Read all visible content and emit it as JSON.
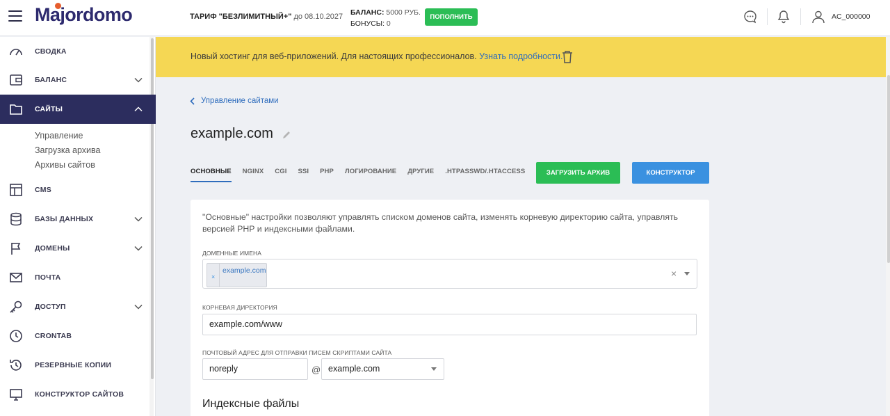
{
  "header": {
    "logo": "Majordomo",
    "tariff_label": "ТАРИФ \"БЕЗЛИМИТНЫЙ+\"",
    "tariff_until": "до 08.10.2027",
    "balance_label": "БАЛАНС:",
    "balance_value": "5000 РУБ.",
    "bonus_label": "БОНУСЫ:",
    "bonus_value": "0",
    "topup_label": "ПОПОЛНИТЬ",
    "user_name": "AC_000000"
  },
  "sidebar": {
    "items": [
      {
        "label": "СВОДКА",
        "icon": "gauge-icon"
      },
      {
        "label": "БАЛАНС",
        "icon": "wallet-icon"
      },
      {
        "label": "САЙТЫ",
        "icon": "folder-icon"
      },
      {
        "label": "CMS",
        "icon": "layout-icon"
      },
      {
        "label": "БАЗЫ ДАННЫХ",
        "icon": "database-icon"
      },
      {
        "label": "ДОМЕНЫ",
        "icon": "flag-icon"
      },
      {
        "label": "ПОЧТА",
        "icon": "mail-icon"
      },
      {
        "label": "ДОСТУП",
        "icon": "key-icon"
      },
      {
        "label": "CRONTAB",
        "icon": "clock-icon"
      },
      {
        "label": "РЕЗЕРВНЫЕ КОПИИ",
        "icon": "history-icon"
      },
      {
        "label": "КОНСТРУКТОР САЙТОВ",
        "icon": "monitor-icon"
      }
    ],
    "sites_sub": [
      "Управление",
      "Загрузка архива",
      "Архивы сайтов"
    ]
  },
  "banner": {
    "text": "Новый хостинг для веб-приложений. Для настоящих профессионалов.",
    "link": "Узнать подробности."
  },
  "main": {
    "breadcrumb": "Управление сайтами",
    "title": "example.com",
    "tabs": [
      "ОСНОВНЫЕ",
      "NGINX",
      "CGI",
      "SSI",
      "PHP",
      "ЛОГИРОВАНИЕ",
      "ДРУГИЕ",
      ".HTPASSWD/.HTACCESS"
    ],
    "upload_archive_label": "ЗАГРУЗИТЬ АРХИВ",
    "builder_label": "КОНСТРУКТОР",
    "description": "\"Основные\" настройки позволяют управлять списком доменов сайта, изменять корневую директорию сайта, управлять версией PHP и индексными файлами.",
    "domains_label": "ДОМЕННЫЕ ИМЕНА",
    "domain_chip": "example.com",
    "chip_remove": "×",
    "clear_symbol": "×",
    "root_label": "КОРНЕВАЯ ДИРЕКТОРИЯ",
    "root_value": "example.com/www",
    "mail_label": "ПОЧТОВЫЙ АДРЕС ДЛЯ ОТПРАВКИ ПИСЕМ СКРИПТАМИ САЙТА",
    "mail_user": "noreply",
    "at": "@",
    "mail_domain": "example.com",
    "index_title": "Индексные файлы"
  },
  "colors": {
    "nav_active": "#2c2d5e",
    "green": "#2bbd55",
    "blue": "#3a91e0",
    "banner": "#f5d754",
    "link": "#2f6dbd"
  }
}
